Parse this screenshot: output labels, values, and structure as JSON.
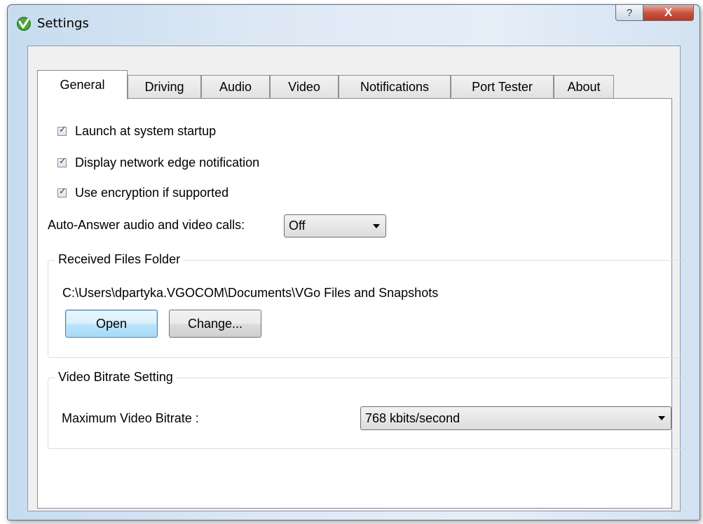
{
  "window": {
    "title": "Settings",
    "help_glyph": "?",
    "close_glyph": "X"
  },
  "tabs": [
    {
      "label": "General",
      "active": true
    },
    {
      "label": "Driving",
      "active": false
    },
    {
      "label": "Audio",
      "active": false
    },
    {
      "label": "Video",
      "active": false
    },
    {
      "label": "Notifications",
      "active": false
    },
    {
      "label": "Port Tester",
      "active": false
    },
    {
      "label": "About",
      "active": false
    }
  ],
  "general": {
    "checkboxes": [
      {
        "label": "Launch at system startup",
        "checked": true
      },
      {
        "label": "Display network edge notification",
        "checked": true
      },
      {
        "label": "Use encryption if supported",
        "checked": true
      }
    ],
    "auto_answer": {
      "label": "Auto-Answer audio and video calls:",
      "value": "Off"
    },
    "received_files": {
      "title": "Received Files Folder",
      "path": "C:\\Users\\dpartyka.VGOCOM\\Documents\\VGo Files and Snapshots",
      "open_label": "Open",
      "change_label": "Change..."
    },
    "video_bitrate": {
      "title": "Video Bitrate Setting",
      "label": "Maximum Video Bitrate :",
      "value": "768 kbits/second"
    }
  },
  "icons": {
    "app": "vgo-logo-icon",
    "help": "help-icon",
    "close": "close-icon",
    "combo": "chevron-down-icon",
    "check": "checkmark-icon"
  },
  "colors": {
    "frame_blue": "#c6dcef",
    "close_red": "#c8503c",
    "default_button_blue": "#bee6fd",
    "logo_green": "#3b8a2f"
  }
}
